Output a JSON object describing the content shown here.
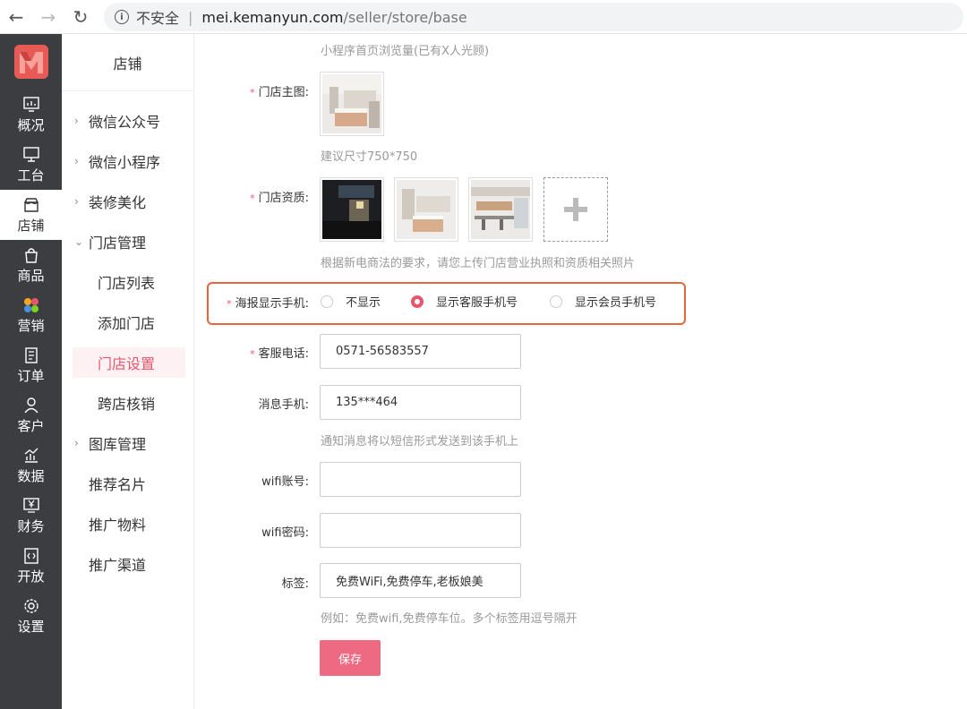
{
  "browser": {
    "back_icon": "←",
    "forward_icon": "→",
    "reload_icon": "↻",
    "info_glyph": "i",
    "insecure_label": "不安全",
    "separator": "|",
    "url_host": "mei.kemanyun.com",
    "url_path": "/seller/store/base"
  },
  "sidebar": {
    "items": [
      {
        "label": "概况",
        "icon": "monitor-chart-icon"
      },
      {
        "label": "工台",
        "icon": "desktop-icon"
      },
      {
        "label": "店铺",
        "icon": "store-icon",
        "active": true
      },
      {
        "label": "商品",
        "icon": "bag-icon"
      },
      {
        "label": "营销",
        "icon": "marketing-icon"
      },
      {
        "label": "订单",
        "icon": "order-icon"
      },
      {
        "label": "客户",
        "icon": "user-icon"
      },
      {
        "label": "数据",
        "icon": "data-icon"
      },
      {
        "label": "财务",
        "icon": "finance-icon"
      },
      {
        "label": "开放",
        "icon": "code-icon"
      },
      {
        "label": "设置",
        "icon": "settings-icon"
      }
    ],
    "accent": "#e85a55"
  },
  "subnav": {
    "title": "店铺",
    "items": [
      {
        "label": "微信公众号",
        "chevron": "›"
      },
      {
        "label": "微信小程序",
        "chevron": "›"
      },
      {
        "label": "装修美化",
        "chevron": "›"
      },
      {
        "label": "门店管理",
        "chevron": "⌄"
      },
      {
        "label": "门店列表"
      },
      {
        "label": "添加门店"
      },
      {
        "label": "门店设置",
        "selected": true
      },
      {
        "label": "跨店核销"
      },
      {
        "label": "图库管理",
        "chevron": "›"
      },
      {
        "label": "推荐名片"
      },
      {
        "label": "推广物料"
      },
      {
        "label": "推广渠道"
      }
    ]
  },
  "form": {
    "top_hint": "小程序首页浏览量(已有X人光顾)",
    "main_image": {
      "label": "门店主图:",
      "hint": "建议尺寸750*750"
    },
    "qualification": {
      "label": "门店资质:",
      "hint": "根据新电商法的要求，请您上传门店营业执照和资质相关照片"
    },
    "poster_phone": {
      "label": "海报显示手机:",
      "options": [
        "不显示",
        "显示客服手机号",
        "显示会员手机号"
      ],
      "selected_index": 1
    },
    "service_phone": {
      "label": "客服电话:",
      "value": "0571-56583557"
    },
    "message_phone": {
      "label": "消息手机:",
      "value": "135***464",
      "hint": "通知消息将以短信形式发送到该手机上"
    },
    "wifi_account": {
      "label": "wifi账号:",
      "value": ""
    },
    "wifi_password": {
      "label": "wifi密码:",
      "value": ""
    },
    "tags": {
      "label": "标签:",
      "value": "免费WiFi,免费停车,老板娘美",
      "hint": "例如：免费wifi,免费停车位。多个标签用逗号隔开"
    },
    "required_mark": "*",
    "save_label": "保存"
  },
  "colors": {
    "primary": "#e8566d",
    "save_button": "#ee6a83",
    "highlight_border": "#e8643c",
    "sidebar_bg": "#3c3d41"
  }
}
